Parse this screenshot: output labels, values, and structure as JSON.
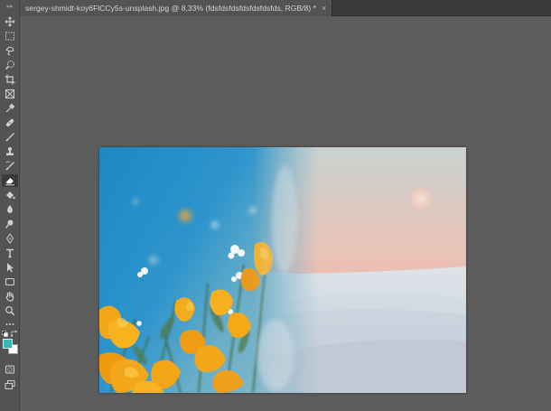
{
  "document": {
    "tab_title": "sergey-shmidt-koy6FlCCy5s-unsplash.jpg @ 8,33% (fdsfdsfdsfdsfdsfdsfds, RGB/8) *",
    "close_glyph": "×"
  },
  "toolbar": {
    "tools": [
      {
        "name": "move-tool",
        "icon": "move-icon",
        "active": false
      },
      {
        "name": "rectangular-marquee-tool",
        "icon": "marquee-icon",
        "active": false
      },
      {
        "name": "lasso-tool",
        "icon": "lasso-icon",
        "active": false
      },
      {
        "name": "quick-selection-tool",
        "icon": "quick-selection-icon",
        "active": false
      },
      {
        "name": "crop-tool",
        "icon": "crop-icon",
        "active": false
      },
      {
        "name": "frame-tool",
        "icon": "frame-icon",
        "active": false
      },
      {
        "name": "eyedropper-tool",
        "icon": "eyedropper-icon",
        "active": false
      },
      {
        "name": "healing-brush-tool",
        "icon": "bandage-icon",
        "active": false
      },
      {
        "name": "brush-tool",
        "icon": "brush-icon",
        "active": false
      },
      {
        "name": "clone-stamp-tool",
        "icon": "stamp-icon",
        "active": false
      },
      {
        "name": "history-brush-tool",
        "icon": "history-brush-icon",
        "active": false
      },
      {
        "name": "eraser-tool",
        "icon": "eraser-icon",
        "active": true
      },
      {
        "name": "paint-bucket-tool",
        "icon": "paint-bucket-icon",
        "active": false
      },
      {
        "name": "blur-tool",
        "icon": "drop-icon",
        "active": false
      },
      {
        "name": "dodge-tool",
        "icon": "dodge-icon",
        "active": false
      },
      {
        "name": "pen-tool",
        "icon": "pen-icon",
        "active": false
      },
      {
        "name": "type-tool",
        "icon": "type-icon",
        "active": false
      },
      {
        "name": "path-selection-tool",
        "icon": "arrow-icon",
        "active": false
      },
      {
        "name": "rectangle-tool",
        "icon": "rectangle-icon",
        "active": false
      },
      {
        "name": "hand-tool",
        "icon": "hand-icon",
        "active": false
      },
      {
        "name": "zoom-tool",
        "icon": "zoom-icon",
        "active": false
      },
      {
        "name": "edit-toolbar",
        "icon": "more-icon",
        "active": false
      }
    ],
    "bottom_tools": [
      {
        "name": "quick-mask-mode",
        "icon": "quick-mask-icon"
      },
      {
        "name": "screen-mode",
        "icon": "screen-mode-icon"
      }
    ]
  },
  "colors": {
    "foreground": "#3bb6b8",
    "background": "#ffffff",
    "workspace": "#5d5d5d",
    "panel": "#535353",
    "tabbar": "#3b3b3b"
  }
}
